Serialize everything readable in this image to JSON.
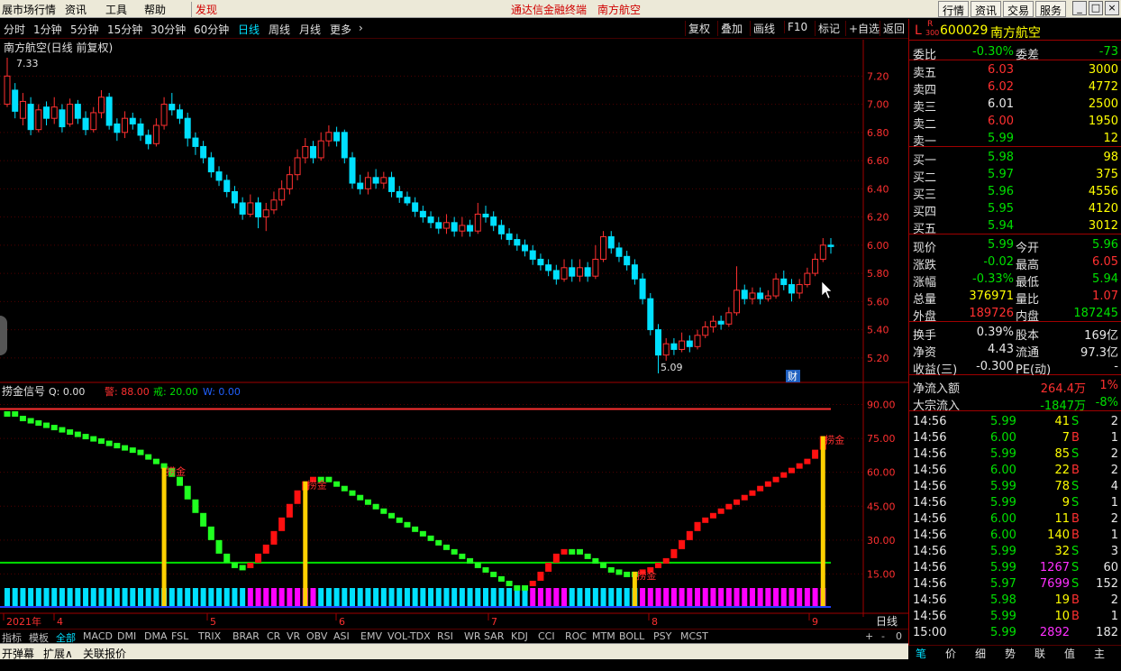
{
  "menubar": {
    "items": [
      "展市场行情",
      "资讯",
      "工具",
      "帮助",
      "发现"
    ],
    "title": "通达信金融终端",
    "stock_name": "南方航空",
    "right_buttons": [
      "行情",
      "资讯",
      "交易",
      "服务"
    ]
  },
  "toolbar": {
    "periods": [
      "分时",
      "1分钟",
      "5分钟",
      "15分钟",
      "30分钟",
      "60分钟",
      "日线",
      "周线",
      "月线",
      "更多"
    ],
    "active": "日线",
    "right": [
      "复权",
      "叠加",
      "画线",
      "F10",
      "标记",
      "+自选",
      "返回"
    ]
  },
  "main_chart": {
    "title": "南方航空(日线 前复权)",
    "high_label": "7.33",
    "low_label": "5.09",
    "fin_badge": "财",
    "yticks": [
      "7.20",
      "7.00",
      "6.80",
      "6.60",
      "6.40",
      "6.20",
      "6.00",
      "5.80",
      "5.60",
      "5.40",
      "5.20"
    ]
  },
  "indicator": {
    "name": "捞金信号",
    "q": "Q: 0.00",
    "jing": "警: 88.00",
    "jie": "戒: 20.00",
    "w": "W: 0.00",
    "yticks": [
      "90.00",
      "75.00",
      "60.00",
      "45.00",
      "30.00",
      "15.00"
    ],
    "signals": [
      "捞金",
      "捞金",
      "捞金",
      "捞金"
    ]
  },
  "x_axis": {
    "labels": [
      "2021年",
      "4",
      "5",
      "6",
      "7",
      "8",
      "9"
    ],
    "period": "日线"
  },
  "bottom_tabs": {
    "items": [
      "指标",
      "模板",
      "全部",
      "MACD",
      "DMI",
      "DMA",
      "FSL",
      "TRIX",
      "BRAR",
      "CR",
      "VR",
      "OBV",
      "ASI",
      "EMV",
      "VOL-TDX",
      "RSI",
      "WR",
      "SAR",
      "KDJ",
      "CCI",
      "ROC",
      "MTM",
      "BOLL",
      "PSY",
      "MCST"
    ],
    "active": "全部",
    "controls": [
      "+",
      "-",
      "0"
    ]
  },
  "bottom_bar2": {
    "items": [
      "开弹幕",
      "扩展∧",
      "关联报价"
    ]
  },
  "quote": {
    "code": "600029",
    "name": "南方航空",
    "badge_l": "L",
    "badge_r": "R",
    "badge_300": "300",
    "weibi_label": "委比",
    "weibi": "-0.30%",
    "weicha_label": "委差",
    "weicha": "-73",
    "sells": [
      {
        "label": "卖五",
        "price": "6.03",
        "vol": "3000"
      },
      {
        "label": "卖四",
        "price": "6.02",
        "vol": "4772"
      },
      {
        "label": "卖三",
        "price": "6.01",
        "vol": "2500"
      },
      {
        "label": "卖二",
        "price": "6.00",
        "vol": "1950"
      },
      {
        "label": "卖一",
        "price": "5.99",
        "vol": "12"
      }
    ],
    "buys": [
      {
        "label": "买一",
        "price": "5.98",
        "vol": "98"
      },
      {
        "label": "买二",
        "price": "5.97",
        "vol": "375"
      },
      {
        "label": "买三",
        "price": "5.96",
        "vol": "4556"
      },
      {
        "label": "买四",
        "price": "5.95",
        "vol": "4120"
      },
      {
        "label": "买五",
        "price": "5.94",
        "vol": "3012"
      }
    ],
    "stats": [
      {
        "l1": "现价",
        "v1": "5.99",
        "c1": "green",
        "l2": "今开",
        "v2": "5.96",
        "c2": "green"
      },
      {
        "l1": "涨跌",
        "v1": "-0.02",
        "c1": "green",
        "l2": "最高",
        "v2": "6.05",
        "c2": "red"
      },
      {
        "l1": "涨幅",
        "v1": "-0.33%",
        "c1": "green",
        "l2": "最低",
        "v2": "5.94",
        "c2": "green"
      },
      {
        "l1": "总量",
        "v1": "376971",
        "c1": "yellow",
        "l2": "量比",
        "v2": "1.07",
        "c2": "red"
      },
      {
        "l1": "外盘",
        "v1": "189726",
        "c1": "red",
        "l2": "内盘",
        "v2": "187245",
        "c2": "green"
      }
    ],
    "stats2": [
      {
        "l1": "换手",
        "v1": "0.39%",
        "l2": "股本",
        "v2": "169亿"
      },
      {
        "l1": "净资",
        "v1": "4.43",
        "l2": "流通",
        "v2": "97.3亿"
      },
      {
        "l1": "收益(三)",
        "v1": "-0.300",
        "l2": "PE(动)",
        "v2": "-"
      }
    ],
    "flow": [
      {
        "label": "净流入额",
        "val": "264.4万",
        "pct": "1%",
        "c": "red"
      },
      {
        "label": "大宗流入",
        "val": "-1847万",
        "pct": "-8%",
        "c": "green"
      }
    ],
    "ticks": [
      {
        "t": "14:56",
        "p": "5.99",
        "pc": "green",
        "v": "41",
        "d": "S",
        "n": "2"
      },
      {
        "t": "14:56",
        "p": "6.00",
        "pc": "green",
        "v": "7",
        "d": "B",
        "n": "1"
      },
      {
        "t": "14:56",
        "p": "5.99",
        "pc": "green",
        "v": "85",
        "d": "S",
        "n": "2"
      },
      {
        "t": "14:56",
        "p": "6.00",
        "pc": "green",
        "v": "22",
        "d": "B",
        "n": "2"
      },
      {
        "t": "14:56",
        "p": "5.99",
        "pc": "green",
        "v": "78",
        "d": "S",
        "n": "4"
      },
      {
        "t": "14:56",
        "p": "5.99",
        "pc": "green",
        "v": "9",
        "d": "S",
        "n": "1"
      },
      {
        "t": "14:56",
        "p": "6.00",
        "pc": "green",
        "v": "11",
        "d": "B",
        "n": "2"
      },
      {
        "t": "14:56",
        "p": "6.00",
        "pc": "green",
        "v": "140",
        "d": "B",
        "n": "1"
      },
      {
        "t": "14:56",
        "p": "5.99",
        "pc": "green",
        "v": "32",
        "d": "S",
        "n": "3"
      },
      {
        "t": "14:56",
        "p": "5.99",
        "pc": "green",
        "v": "1267",
        "d": "S",
        "n": "60"
      },
      {
        "t": "14:56",
        "p": "5.97",
        "pc": "green",
        "v": "7699",
        "d": "S",
        "n": "152"
      },
      {
        "t": "14:56",
        "p": "5.98",
        "pc": "green",
        "v": "19",
        "d": "B",
        "n": "2"
      },
      {
        "t": "14:56",
        "p": "5.99",
        "pc": "green",
        "v": "10",
        "d": "B",
        "n": "1"
      },
      {
        "t": "15:00",
        "p": "5.99",
        "pc": "green",
        "v": "2892",
        "d": "",
        "n": "182"
      }
    ],
    "tabs": [
      "笔",
      "价",
      "细",
      "势",
      "联",
      "值",
      "主"
    ],
    "active_tab": "笔"
  },
  "colors": {
    "up": "#ff3030",
    "down": "#00e0ff",
    "green": "#00e000",
    "yellow": "#ffff00",
    "magenta": "#ff00ff"
  },
  "chart_data": {
    "type": "candlestick",
    "ylim": [
      5.09,
      7.33
    ],
    "candles": [
      [
        7.0,
        7.2,
        7.33,
        6.98
      ],
      [
        7.1,
        6.95,
        7.15,
        6.9
      ],
      [
        6.9,
        7.02,
        7.08,
        6.85
      ],
      [
        7.0,
        6.82,
        7.05,
        6.78
      ],
      [
        6.82,
        6.96,
        7.0,
        6.8
      ],
      [
        6.98,
        6.9,
        7.02,
        6.85
      ],
      [
        6.9,
        6.98,
        7.05,
        6.86
      ],
      [
        6.96,
        6.84,
        7.0,
        6.8
      ],
      [
        6.86,
        7.0,
        7.04,
        6.84
      ],
      [
        7.0,
        6.9,
        7.03,
        6.86
      ],
      [
        6.9,
        6.82,
        6.95,
        6.78
      ],
      [
        6.82,
        6.94,
        6.98,
        6.8
      ],
      [
        6.94,
        7.05,
        7.1,
        6.9
      ],
      [
        7.05,
        6.85,
        7.08,
        6.82
      ],
      [
        6.86,
        6.8,
        6.9,
        6.74
      ],
      [
        6.8,
        6.9,
        6.95,
        6.76
      ],
      [
        6.9,
        6.86,
        6.94,
        6.82
      ],
      [
        6.86,
        6.78,
        6.9,
        6.74
      ],
      [
        6.78,
        6.72,
        6.82,
        6.68
      ],
      [
        6.72,
        6.85,
        6.9,
        6.7
      ],
      [
        6.85,
        7.0,
        7.05,
        6.82
      ],
      [
        7.0,
        6.96,
        7.08,
        6.92
      ],
      [
        6.96,
        6.9,
        7.0,
        6.86
      ],
      [
        6.9,
        6.76,
        6.94,
        6.7
      ],
      [
        6.76,
        6.7,
        6.8,
        6.64
      ],
      [
        6.7,
        6.62,
        6.74,
        6.58
      ],
      [
        6.62,
        6.52,
        6.66,
        6.48
      ],
      [
        6.52,
        6.46,
        6.56,
        6.42
      ],
      [
        6.46,
        6.38,
        6.5,
        6.34
      ],
      [
        6.38,
        6.3,
        6.42,
        6.26
      ],
      [
        6.3,
        6.22,
        6.34,
        6.18
      ],
      [
        6.22,
        6.3,
        6.36,
        6.2
      ],
      [
        6.3,
        6.2,
        6.34,
        6.12
      ],
      [
        6.2,
        6.25,
        6.3,
        6.1
      ],
      [
        6.25,
        6.32,
        6.38,
        6.22
      ],
      [
        6.32,
        6.4,
        6.46,
        6.28
      ],
      [
        6.4,
        6.5,
        6.56,
        6.36
      ],
      [
        6.5,
        6.62,
        6.68,
        6.46
      ],
      [
        6.62,
        6.7,
        6.76,
        6.58
      ],
      [
        6.7,
        6.62,
        6.74,
        6.58
      ],
      [
        6.62,
        6.74,
        6.8,
        6.6
      ],
      [
        6.74,
        6.8,
        6.85,
        6.7
      ],
      [
        6.8,
        6.74,
        6.84,
        6.7
      ],
      [
        6.8,
        6.62,
        6.82,
        6.58
      ],
      [
        6.62,
        6.44,
        6.66,
        6.4
      ],
      [
        6.44,
        6.4,
        6.5,
        6.36
      ],
      [
        6.4,
        6.48,
        6.52,
        6.36
      ],
      [
        6.48,
        6.44,
        6.54,
        6.4
      ],
      [
        6.44,
        6.48,
        6.52,
        6.4
      ],
      [
        6.48,
        6.38,
        6.52,
        6.34
      ],
      [
        6.38,
        6.34,
        6.42,
        6.3
      ],
      [
        6.34,
        6.3,
        6.38,
        6.28
      ],
      [
        6.3,
        6.24,
        6.34,
        6.2
      ],
      [
        6.24,
        6.2,
        6.28,
        6.16
      ],
      [
        6.2,
        6.16,
        6.24,
        6.12
      ],
      [
        6.16,
        6.12,
        6.2,
        6.08
      ],
      [
        6.12,
        6.16,
        6.22,
        6.08
      ],
      [
        6.16,
        6.1,
        6.2,
        6.06
      ],
      [
        6.1,
        6.14,
        6.2,
        6.06
      ],
      [
        6.14,
        6.1,
        6.18,
        6.06
      ],
      [
        6.1,
        6.22,
        6.3,
        6.08
      ],
      [
        6.22,
        6.2,
        6.28,
        6.16
      ],
      [
        6.2,
        6.14,
        6.24,
        6.1
      ],
      [
        6.14,
        6.08,
        6.18,
        6.04
      ],
      [
        6.08,
        6.04,
        6.12,
        6.0
      ],
      [
        6.04,
        6.0,
        6.08,
        5.96
      ],
      [
        6.0,
        5.96,
        6.04,
        5.92
      ],
      [
        5.96,
        5.9,
        6.0,
        5.86
      ],
      [
        5.9,
        5.86,
        5.94,
        5.82
      ],
      [
        5.86,
        5.82,
        5.9,
        5.78
      ],
      [
        5.82,
        5.76,
        5.86,
        5.72
      ],
      [
        5.76,
        5.84,
        5.9,
        5.74
      ],
      [
        5.84,
        5.78,
        5.9,
        5.74
      ],
      [
        5.78,
        5.84,
        5.9,
        5.74
      ],
      [
        5.84,
        5.78,
        5.88,
        5.74
      ],
      [
        5.78,
        5.9,
        6.0,
        5.76
      ],
      [
        5.9,
        6.06,
        6.1,
        5.88
      ],
      [
        6.06,
        5.98,
        6.1,
        5.94
      ],
      [
        5.98,
        5.92,
        6.02,
        5.88
      ],
      [
        5.92,
        5.86,
        5.96,
        5.82
      ],
      [
        5.86,
        5.76,
        5.9,
        5.72
      ],
      [
        5.76,
        5.62,
        5.8,
        5.58
      ],
      [
        5.62,
        5.4,
        5.66,
        5.36
      ],
      [
        5.4,
        5.22,
        5.44,
        5.09
      ],
      [
        5.22,
        5.3,
        5.34,
        5.18
      ],
      [
        5.3,
        5.26,
        5.34,
        5.22
      ],
      [
        5.26,
        5.32,
        5.38,
        5.24
      ],
      [
        5.32,
        5.28,
        5.36,
        5.24
      ],
      [
        5.28,
        5.36,
        5.4,
        5.26
      ],
      [
        5.36,
        5.42,
        5.46,
        5.34
      ],
      [
        5.42,
        5.46,
        5.5,
        5.38
      ],
      [
        5.46,
        5.44,
        5.5,
        5.4
      ],
      [
        5.44,
        5.52,
        5.56,
        5.42
      ],
      [
        5.52,
        5.68,
        5.85,
        5.5
      ],
      [
        5.68,
        5.62,
        5.72,
        5.58
      ],
      [
        5.62,
        5.66,
        5.7,
        5.58
      ],
      [
        5.66,
        5.62,
        5.7,
        5.58
      ],
      [
        5.62,
        5.64,
        5.68,
        5.6
      ],
      [
        5.64,
        5.76,
        5.8,
        5.62
      ],
      [
        5.76,
        5.72,
        5.82,
        5.68
      ],
      [
        5.72,
        5.66,
        5.76,
        5.6
      ],
      [
        5.66,
        5.72,
        5.76,
        5.62
      ],
      [
        5.72,
        5.8,
        5.84,
        5.7
      ],
      [
        5.8,
        5.9,
        5.94,
        5.78
      ],
      [
        5.9,
        6.0,
        6.05,
        5.88
      ],
      [
        6.0,
        5.99,
        6.05,
        5.94
      ]
    ],
    "indicator_values": [
      87,
      85,
      84,
      83,
      82,
      81,
      80,
      79,
      78,
      77,
      76,
      75,
      74,
      73,
      72,
      71,
      70,
      68,
      66,
      64,
      62,
      58,
      54,
      48,
      42,
      36,
      30,
      24,
      20,
      19,
      18,
      20,
      24,
      28,
      34,
      40,
      46,
      52,
      56,
      58,
      58,
      56,
      54,
      52,
      50,
      48,
      46,
      44,
      42,
      40,
      38,
      36,
      34,
      32,
      30,
      28,
      26,
      24,
      22,
      20,
      18,
      16,
      14,
      12,
      10,
      10,
      10,
      12,
      16,
      20,
      24,
      26,
      26,
      24,
      22,
      20,
      18,
      17,
      16,
      16,
      16,
      17,
      18,
      20,
      22,
      26,
      30,
      34,
      38,
      40,
      42,
      44,
      46,
      48,
      50,
      52,
      54,
      56,
      58,
      60,
      62,
      64,
      66,
      70,
      76
    ],
    "indicator_colors_up_from": [
      0,
      "green"
    ],
    "signal_positions": [
      20,
      38,
      80,
      104
    ],
    "warn_level": 88,
    "alert_level": 20
  }
}
